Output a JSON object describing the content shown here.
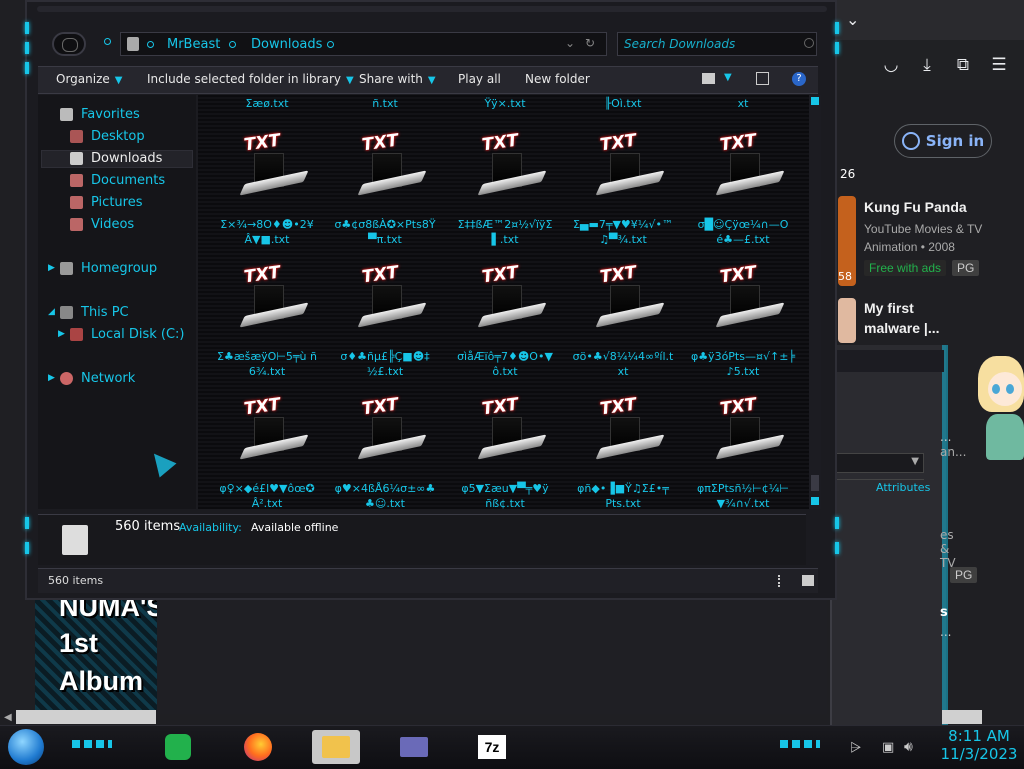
{
  "browser": {
    "sign_in": "Sign in",
    "rec1": {
      "title": "Kung Fu Panda",
      "sub1": "YouTube Movies & TV",
      "sub2": "Animation • 2008",
      "badge": "Free with ads",
      "rating": "PG"
    },
    "rec2": {
      "title_line1": "My first",
      "title_line2": "malware |..."
    },
    "frag_26": "26",
    "frag_58": "58",
    "frag_an": "an...",
    "frag_es_tv": "es & TV",
    "frag_pg": "PG",
    "frag_s": "s",
    "frag_dots": "...",
    "attributes": "Attributes"
  },
  "explorer": {
    "crumbs": [
      "MrBeast",
      "Downloads"
    ],
    "search_placeholder": "Search Downloads",
    "commands": [
      "Organize",
      "Include selected folder in library",
      "Share with",
      "Play all",
      "New folder"
    ],
    "nav": {
      "favorites": "Favorites",
      "desktop": "Desktop",
      "downloads": "Downloads",
      "documents": "Documents",
      "pictures": "Pictures",
      "videos": "Videos",
      "homegroup": "Homegroup",
      "this_pc": "This PC",
      "local_disk": "Local Disk (C:)",
      "network": "Network"
    },
    "top_row": [
      "Σæø.txt",
      "ñ.txt",
      "Ÿÿ×.txt",
      "╟Oì.txt",
      "xt"
    ],
    "files": [
      {
        "line1": "Σ×¾→8O♦☻•2¥",
        "line2": "Â▼■.txt"
      },
      {
        "line1": "σ♣¢σ8ßÀ✪×Pts8Ÿ",
        "line2": "▀π.txt"
      },
      {
        "line1": "Σ‡‡ßÆ™2¤½√ïÿΣ",
        "line2": "▌.txt"
      },
      {
        "line1": "Σ▄▬7╤▼♥¥¼√•™",
        "line2": "♫▀¾.txt"
      },
      {
        "line1": "σ█☺Çÿœ¼∩—O",
        "line2": "é♣—£.txt"
      },
      {
        "line1": "Σ♣æšæÿO⊢5╤ù ñ",
        "line2": "6¾.txt"
      },
      {
        "line1": "σ♦♣ñµ£╠Ç■☻‡",
        "line2": "½£.txt"
      },
      {
        "line1": "σìåÆïô╤7♦☻O•▼",
        "line2": "ô.txt"
      },
      {
        "line1": "σö•♣√8¼¼4∞ºíl.t",
        "line2": "xt"
      },
      {
        "line1": "φ♣ÿ3óPts—¤√↑±╞",
        "line2": "♪5.txt"
      },
      {
        "line1": "φ♀×◆é£l♥▼ôœ✪",
        "line2": "Â².txt"
      },
      {
        "line1": "φ♥×4ßÅ6¼σ±∞♣",
        "line2": "♣☺.txt"
      },
      {
        "line1": "φ5▼Σæu▼▀╤♥ÿ",
        "line2": "ñß¢.txt"
      },
      {
        "line1": "φñ◆•▐■Ÿ♫Σ£•╤",
        "line2": "Pts.txt"
      },
      {
        "line1": "φπΣPtsñ½⊢¢¼⊢",
        "line2": "▼¾∩√.txt"
      }
    ],
    "details": {
      "count": "560 items",
      "availability_label": "Availability:",
      "availability_value": "Available offline"
    },
    "status": "560 items"
  },
  "album": {
    "line1": "NUMA'S",
    "line2": "1st",
    "line3": "Album"
  },
  "taskbar": {
    "time": "8:11 AM",
    "date": "11/3/2023"
  },
  "colors": {
    "accent": "#17c6e8",
    "bg": "#1b1b20",
    "text": "#e8e8e8",
    "ff_orange": "#ff6d1e",
    "green": "#22b14c"
  }
}
